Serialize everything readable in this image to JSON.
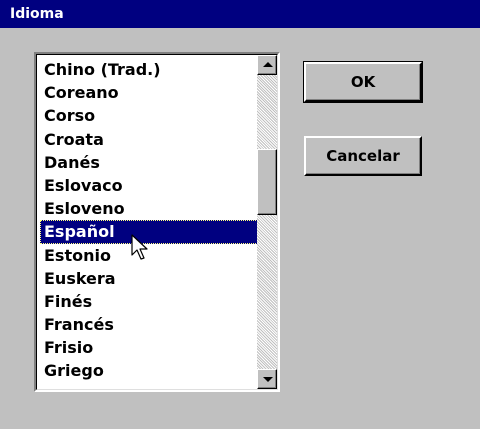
{
  "window": {
    "title": "Idioma"
  },
  "listbox": {
    "items": [
      "Chino (Trad.)",
      "Coreano",
      "Corso",
      "Croata",
      "Danés",
      "Eslovaco",
      "Esloveno",
      "Español",
      "Estonio",
      "Euskera",
      "Finés",
      "Francés",
      "Frisio",
      "Griego"
    ],
    "selected": "Español"
  },
  "buttons": {
    "ok_label": "OK",
    "cancel_label": "Cancelar"
  },
  "colors": {
    "titlebar": "#000080",
    "face": "#c0c0c0",
    "selection": "#000080"
  },
  "icons": {
    "scroll_up": "triangle-up",
    "scroll_down": "triangle-down",
    "cursor": "arrow-pointer"
  }
}
